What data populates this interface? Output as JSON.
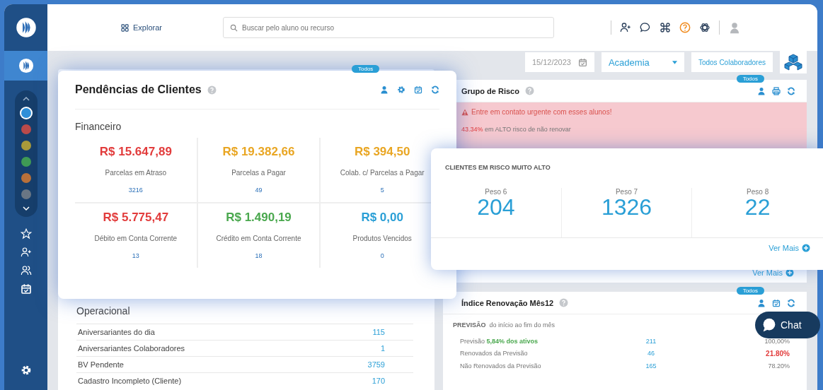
{
  "topbar": {
    "explore": "Explorar",
    "search": {
      "placeholder": "Buscar pelo aluno ou recurso"
    }
  },
  "sidebar": {
    "modules": [
      {
        "color": "#2f8fd8",
        "selected": true
      },
      {
        "color": "#b94a4a",
        "selected": false
      },
      {
        "color": "#a89a3a",
        "selected": false
      },
      {
        "color": "#3f9a55",
        "selected": false
      },
      {
        "color": "#b8703a",
        "selected": false
      },
      {
        "color": "#6a7684",
        "selected": false
      }
    ]
  },
  "filters": {
    "date": "15/12/2023",
    "unit": "Academia",
    "collaborators": "Todos Colaboradores"
  },
  "pendencias": {
    "badge": "Todos",
    "title": "Pendências de Clientes",
    "section": "Financeiro",
    "cells": [
      {
        "amount": "R$ 15.647,89",
        "color": "#e23c3c",
        "label": "Parcelas em Atraso",
        "count": "3216"
      },
      {
        "amount": "R$ 19.382,66",
        "color": "#e9a623",
        "label": "Parcelas a Pagar",
        "count": "49"
      },
      {
        "amount": "R$ 394,50",
        "color": "#e9a623",
        "label": "Colab. c/ Parcelas a Pagar",
        "count": "5"
      },
      {
        "amount": "R$ 5.775,47",
        "color": "#e23c3c",
        "label": "Débito em Conta Corrente",
        "count": "13"
      },
      {
        "amount": "R$ 1.490,19",
        "color": "#4aa84e",
        "label": "Crédito em Conta Corrente",
        "count": "18"
      },
      {
        "amount": "R$ 0,00",
        "color": "#2a9fd6",
        "label": "Produtos Vencidos",
        "count": "0"
      }
    ]
  },
  "operacional": {
    "title": "Operacional",
    "rows": [
      {
        "label": "Aniversariantes do dia",
        "value": "115"
      },
      {
        "label": "Aniversariantes Colaboradores",
        "value": "1"
      },
      {
        "label": "BV Pendente",
        "value": "3759"
      },
      {
        "label": "Cadastro Incompleto (Cliente)",
        "value": "170"
      }
    ]
  },
  "grupo_risco": {
    "badge": "Todos",
    "title": "Grupo de Risco",
    "alert": "Entre em contato urgente com esses alunos!",
    "risk_percent": "43.34%",
    "risk_text": "em ALTO risco de não renovar",
    "more": "Ver Mais"
  },
  "clientes_risco": {
    "title": "CLIENTES EM RISCO MUITO ALTO",
    "groups": [
      {
        "label": "Peso 6",
        "value": "204"
      },
      {
        "label": "Peso 7",
        "value": "1326"
      },
      {
        "label": "Peso 8",
        "value": "22"
      }
    ],
    "more": "Ver Mais"
  },
  "renovacao": {
    "badge": "Todos",
    "title": "Índice Renovação Mês12",
    "caption_bold": "PREVISÃO",
    "caption": "do início ao fim do mês",
    "rows": [
      {
        "label": "Previsão **5,84% dos ativos**",
        "count": "211",
        "percent": "100,00%",
        "alert": false
      },
      {
        "label": "Renovados da Previsão",
        "count": "46",
        "percent": "21.80%",
        "alert": true
      },
      {
        "label": "Não Renovados da Previsão",
        "count": "165",
        "percent": "78.20%",
        "alert": false
      }
    ]
  },
  "chat": {
    "label": "Chat"
  }
}
